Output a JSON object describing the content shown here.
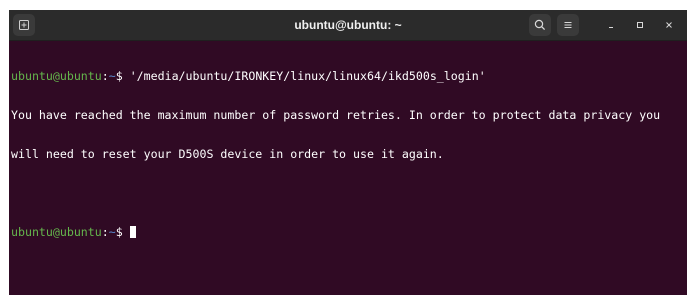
{
  "window": {
    "title": "ubuntu@ubuntu: ~",
    "background_color": "#300a24",
    "titlebar_color": "#2b2b2b"
  },
  "titlebar_icons": {
    "new_tab": "new-tab-icon",
    "search": "search-icon",
    "menu": "hamburger-menu-icon",
    "minimize": "minimize-icon",
    "maximize": "maximize-icon",
    "close": "close-icon"
  },
  "terminal": {
    "prompt_user_host": "ubuntu@ubuntu",
    "prompt_separator": ":",
    "prompt_path": "~",
    "prompt_symbol": "$ ",
    "command": "'/media/ubuntu/IRONKEY/linux/linux64/ikd500s_login'",
    "output_lines": [
      "You have reached the maximum number of password retries. In order to protect data privacy you",
      "will need to reset your D500S device in order to use it again."
    ],
    "prompt_color_user": "#64b54c",
    "prompt_color_path": "#5a8ad0"
  }
}
